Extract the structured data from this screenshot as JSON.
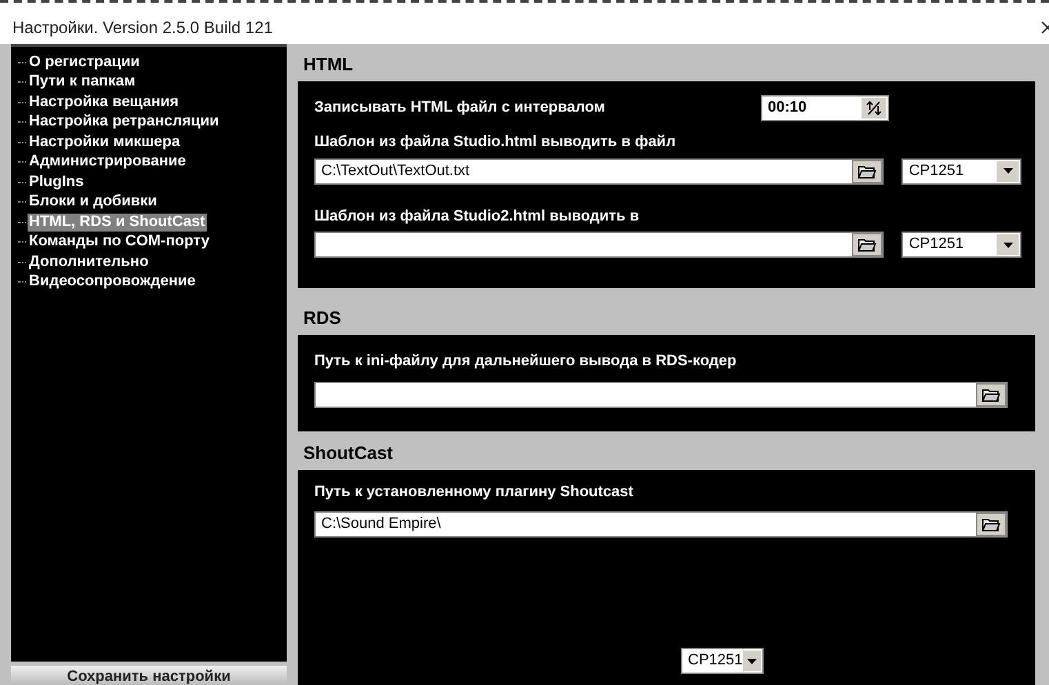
{
  "window": {
    "title": "Настройки. Version 2.5.0 Build 121"
  },
  "sidebar": {
    "items": [
      {
        "label": "О регистрации",
        "selected": false
      },
      {
        "label": "Пути к папкам",
        "selected": false
      },
      {
        "label": "Настройка вещания",
        "selected": false
      },
      {
        "label": "Настройка ретрансляции",
        "selected": false
      },
      {
        "label": "Настройки микшера",
        "selected": false
      },
      {
        "label": "Администрирование",
        "selected": false
      },
      {
        "label": "PlugIns",
        "selected": false
      },
      {
        "label": "Блоки и добивки",
        "selected": false
      },
      {
        "label": "HTML, RDS и ShoutCast",
        "selected": true
      },
      {
        "label": "Команды по COM-порту",
        "selected": false
      },
      {
        "label": "Дополнительно",
        "selected": false
      },
      {
        "label": "Видеосопровождение",
        "selected": false
      }
    ],
    "save_button": "Сохранить настройки"
  },
  "html": {
    "title": "HTML",
    "interval_label": "Записывать HTML файл с интервалом",
    "interval_value": "00:10",
    "template1_label": "Шаблон из файла Studio.html выводить в файл",
    "template1_path": "C:\\TextOut\\TextOut.txt",
    "template1_encoding": "CP1251",
    "template2_label": "Шаблон из файла Studio2.html выводить в",
    "template2_encoding": "CP1251"
  },
  "rds": {
    "title": "RDS",
    "path_label": "Путь к ini-файлу для дальнейшего вывода в RDS-кодер"
  },
  "shoutcast": {
    "title": "ShoutCast",
    "path_label": "Путь к установленному плагину Shoutcast",
    "path_value": "C:\\Sound Empire\\",
    "encoding": "CP1251"
  }
}
